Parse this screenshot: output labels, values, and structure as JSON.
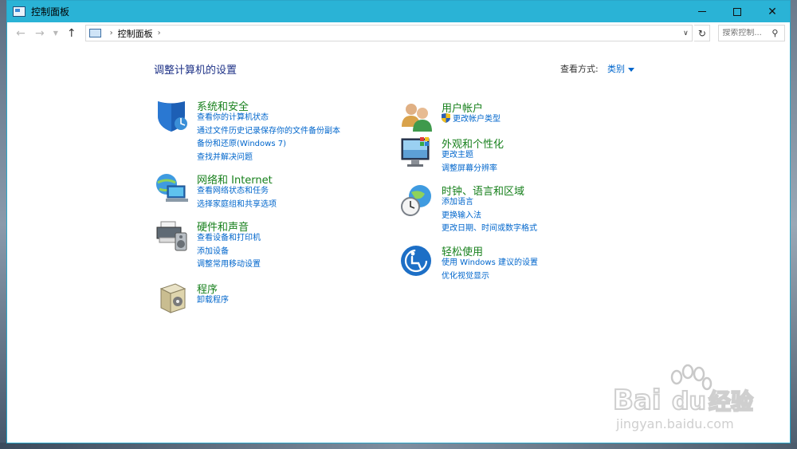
{
  "window": {
    "title": "控制面板",
    "accent": "#2ab3d6"
  },
  "address": {
    "location": "控制面板",
    "search_placeholder": "搜索控制..."
  },
  "main": {
    "heading": "调整计算机的设置",
    "view_by_label": "查看方式:",
    "view_by_value": "类别"
  },
  "left_categories": [
    {
      "name": "系统和安全",
      "icon": "shield-icon",
      "links": [
        "查看你的计算机状态",
        "通过文件历史记录保存你的文件备份副本",
        "备份和还原(Windows 7)",
        "查找并解决问题"
      ]
    },
    {
      "name": "网络和 Internet",
      "icon": "network-globe-icon",
      "links": [
        "查看网络状态和任务",
        "选择家庭组和共享选项"
      ]
    },
    {
      "name": "硬件和声音",
      "icon": "printer-speaker-icon",
      "links": [
        "查看设备和打印机",
        "添加设备",
        "调整常用移动设置"
      ]
    },
    {
      "name": "程序",
      "icon": "programs-box-icon",
      "links": [
        "卸载程序"
      ]
    }
  ],
  "right_categories": [
    {
      "name": "用户帐户",
      "icon": "users-icon",
      "links": [
        "更改帐户类型"
      ]
    },
    {
      "name": "外观和个性化",
      "icon": "monitor-palette-icon",
      "links": [
        "更改主题",
        "调整屏幕分辨率"
      ]
    },
    {
      "name": "时钟、语言和区域",
      "icon": "clock-globe-icon",
      "links": [
        "添加语言",
        "更换输入法",
        "更改日期、时间或数字格式"
      ]
    },
    {
      "name": "轻松使用",
      "icon": "ease-of-access-icon",
      "links": [
        "使用 Windows 建议的设置",
        "优化视觉显示"
      ]
    }
  ],
  "watermark": {
    "brand": "Bai",
    "brand2": "du",
    "cn": "经验",
    "url": "jingyan.baidu.com"
  }
}
